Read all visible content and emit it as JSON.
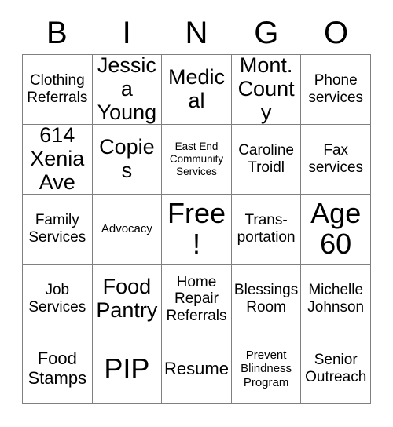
{
  "header": {
    "letters": [
      "B",
      "I",
      "N",
      "G",
      "O"
    ]
  },
  "grid": {
    "rows": [
      [
        {
          "text": "Clothing Referrals",
          "size": "fs-md"
        },
        {
          "text": "Jessica Young",
          "size": "fs-xl"
        },
        {
          "text": "Medical",
          "size": "fs-xl"
        },
        {
          "text": "Mont. County",
          "size": "fs-xl"
        },
        {
          "text": "Phone services",
          "size": "fs-md"
        }
      ],
      [
        {
          "text": "614 Xenia Ave",
          "size": "fs-xl"
        },
        {
          "text": "Copies",
          "size": "fs-xl"
        },
        {
          "text": "East End Community Services",
          "size": "fs-xs"
        },
        {
          "text": "Caroline Troidl",
          "size": "fs-md"
        },
        {
          "text": "Fax services",
          "size": "fs-md"
        }
      ],
      [
        {
          "text": "Family Services",
          "size": "fs-md"
        },
        {
          "text": "Advocacy",
          "size": "fs-sm"
        },
        {
          "text": "Free!",
          "size": "fs-xxl"
        },
        {
          "text": "Trans-portation",
          "size": "fs-md"
        },
        {
          "text": "Age 60",
          "size": "fs-xxl"
        }
      ],
      [
        {
          "text": "Job Services",
          "size": "fs-md"
        },
        {
          "text": "Food Pantry",
          "size": "fs-xl"
        },
        {
          "text": "Home Repair Referrals",
          "size": "fs-md"
        },
        {
          "text": "Blessings Room",
          "size": "fs-md"
        },
        {
          "text": "Michelle Johnson",
          "size": "fs-md"
        }
      ],
      [
        {
          "text": "Food Stamps",
          "size": "fs-lg"
        },
        {
          "text": "PIP",
          "size": "fs-xxl"
        },
        {
          "text": "Resume",
          "size": "fs-lg"
        },
        {
          "text": "Prevent Blindness Program",
          "size": "fs-sm"
        },
        {
          "text": "Senior Outreach",
          "size": "fs-md"
        }
      ]
    ]
  }
}
